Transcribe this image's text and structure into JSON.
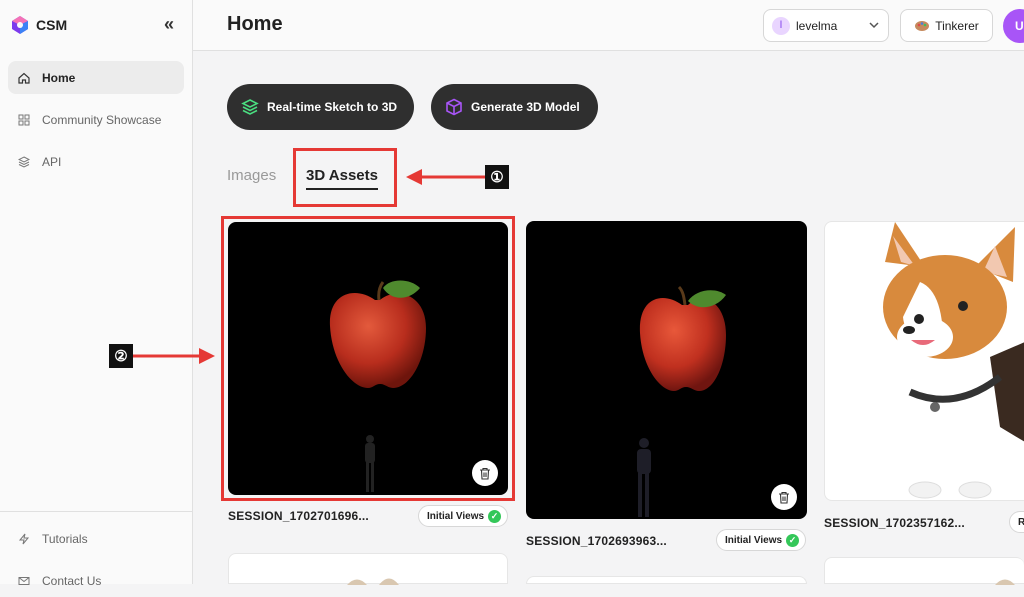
{
  "sidebar": {
    "brand": "CSM",
    "collapse_glyph": "«",
    "items": [
      {
        "label": "Home",
        "icon": "home-icon",
        "active": true
      },
      {
        "label": "Community Showcase",
        "icon": "grid-icon",
        "active": false
      },
      {
        "label": "API",
        "icon": "layers-icon",
        "active": false
      }
    ],
    "bottom_items": [
      {
        "label": "Tutorials",
        "icon": "bolt-icon"
      },
      {
        "label": "Contact Us",
        "icon": "mail-icon"
      }
    ]
  },
  "header": {
    "title": "Home",
    "workspace": {
      "avatar_letter": "l",
      "name": "levelma"
    },
    "tier_label": "Tinkerer",
    "user_avatar_letter": "U"
  },
  "actions": {
    "sketch_label": "Real-time Sketch to 3D",
    "generate_label": "Generate 3D Model"
  },
  "tabs": {
    "images": "Images",
    "assets": "3D Assets"
  },
  "annotations": {
    "marker1": "①",
    "marker2": "②",
    "color": "#e53935"
  },
  "cards": [
    {
      "title": "SESSION_1702701696...",
      "status": "Initial Views"
    },
    {
      "title": "SESSION_1702693963...",
      "status": "Initial Views"
    },
    {
      "title": "SESSION_1702357162...",
      "status": "R"
    }
  ],
  "colors": {
    "accent": "#a855f7",
    "button_bg": "#2f2f2f",
    "success": "#34c759"
  }
}
